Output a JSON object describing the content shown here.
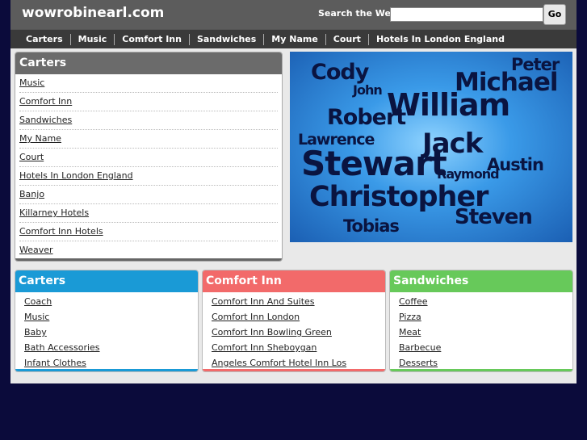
{
  "header": {
    "site_title": "wowrobinearl.com",
    "search_label": "Search the Web:",
    "search_value": "",
    "go_label": "Go"
  },
  "nav": [
    "Carters",
    "Music",
    "Comfort Inn",
    "Sandwiches",
    "My Name",
    "Court",
    "Hotels In London England"
  ],
  "main_box": {
    "title": "Carters",
    "links": [
      "Music",
      "Comfort Inn",
      "Sandwiches",
      "My Name",
      "Court",
      "Hotels In London England",
      "Banjo",
      "Killarney Hotels",
      "Comfort Inn Hotels",
      "Weaver"
    ]
  },
  "name_cloud": {
    "words": [
      "Cody",
      "John",
      "Peter",
      "Michael",
      "William",
      "Robert",
      "Lawrence",
      "Jack",
      "Austin",
      "Stewart",
      "Raymond",
      "Christopher",
      "Steven",
      "Tobias"
    ]
  },
  "boxes": [
    {
      "title": "Carters",
      "color": "#1a9ad6",
      "links": [
        "Coach",
        "Music",
        "Baby",
        "Bath Accessories",
        "Infant Clothes"
      ]
    },
    {
      "title": "Comfort Inn",
      "color": "#f26a6a",
      "links": [
        "Comfort Inn And Suites",
        "Comfort Inn London",
        "Comfort Inn Bowling Green",
        "Comfort Inn Sheboygan",
        "Angeles Comfort Hotel Inn Los"
      ]
    },
    {
      "title": "Sandwiches",
      "color": "#67c95a",
      "links": [
        "Coffee",
        "Pizza",
        "Meat",
        "Barbecue",
        "Desserts"
      ]
    }
  ],
  "colors": {
    "page_background": "#0b0b3b",
    "header_background": "#5c5c5c",
    "nav_background": "#3a3a3a",
    "content_background": "#e9e9e9"
  }
}
